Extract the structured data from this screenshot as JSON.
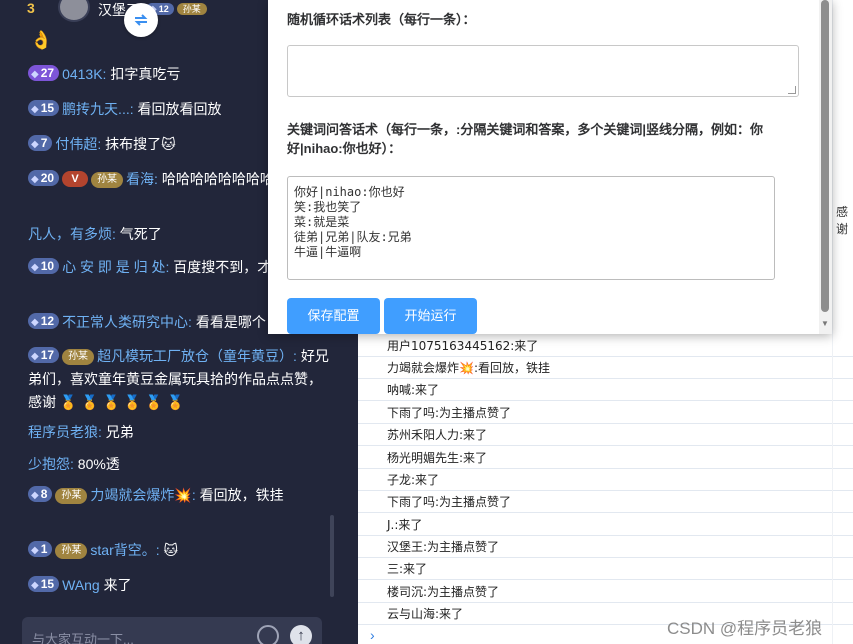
{
  "chat": {
    "header": {
      "rank": "3",
      "name": "汉堡王",
      "fan_badge": "孙某",
      "level": "12"
    },
    "emoji_top": "👌",
    "messages": [
      {
        "level": "27",
        "user": "0413K:",
        "text": "扣字真吃亏"
      },
      {
        "level": "15",
        "user": "鹏抟九天...:",
        "text": "看回放看回放"
      },
      {
        "level": "7",
        "user": "付伟超:",
        "text": "抹布搜了🐱"
      },
      {
        "level": "20",
        "vip": "V",
        "fan": "孙某",
        "user": "看海:",
        "text": "哈哈哈哈哈哈哈哈哈"
      },
      {
        "user": "凡人，有多烦:",
        "text": "气死了"
      },
      {
        "level": "10",
        "user": "心 安 即 是 归 处:",
        "text": "百度搜不到，才行"
      },
      {
        "level": "12",
        "user": "不正常人类研究中心:",
        "text": "看看是哪个"
      },
      {
        "level": "17",
        "fan": "孙某",
        "user": "超凡模玩工厂放仓（童年黄豆）:",
        "text": "好兄弟们，喜欢童年黄豆金属玩具拾的作品点点赞，感谢 🏅 🏅 🏅 🏅 🏅 🏅"
      },
      {
        "user": "程序员老狼:",
        "text": "兄弟"
      },
      {
        "user": "少抱怨:",
        "text": "80%透"
      },
      {
        "level": "8",
        "fan": "孙某",
        "user": "力竭就会爆炸💥:",
        "text": "看回放，铁挂"
      },
      {
        "level": "1",
        "fan": "孙某",
        "user": "star背空。:",
        "text": "🐱"
      },
      {
        "level": "15",
        "user": "WAng",
        "text": "来了"
      }
    ],
    "input_placeholder": "与大家互动一下..."
  },
  "modal": {
    "label_random": "随机循环话术列表（每行一条）：",
    "random_value": "",
    "label_keyword": "关键词问答话术（每行一条，:分隔关键词和答案，多个关键词|竖线分隔，例如：你好|nihao:你也好）：",
    "keyword_value": "你好|nihao:你也好\n笑:我也笑了\n菜:就是菜\n徒弟|兄弟|队友:兄弟\n牛逼|牛逼啊",
    "save_button": "保存配置",
    "run_button": "开始运行"
  },
  "log": {
    "rows": [
      "用户1075163445162:来了",
      "力竭就会爆炸💥:看回放，铁挂",
      "呐喊:来了",
      "下雨了吗:为主播点赞了",
      "苏州禾阳人力:来了",
      "杨光明媚先生:来了",
      "子龙:来了",
      "下雨了吗:为主播点赞了",
      "J.:来了",
      "汉堡王:为主播点赞了",
      "三:来了",
      "楼司沉:为主播点赞了",
      "云与山海:来了"
    ],
    "side_text": "感谢",
    "expand_icon": "chevron-right-icon"
  },
  "watermark": "CSDN @程序员老狼"
}
